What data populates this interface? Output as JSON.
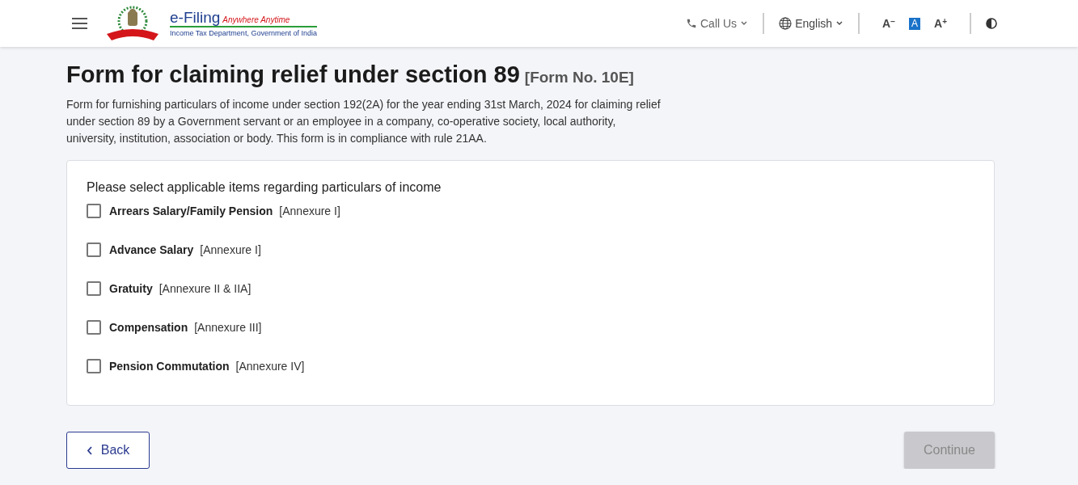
{
  "header": {
    "brand": {
      "name": "e-Filing",
      "tagline": "Anywhere Anytime",
      "department": "Income Tax Department, Government of India"
    },
    "call_us": {
      "label": "Call Us"
    },
    "language": {
      "label": "English"
    },
    "font_size_buttons": [
      {
        "label": "A",
        "sign": "−",
        "selected": false
      },
      {
        "label": "A",
        "selected": true
      },
      {
        "label": "A",
        "sign": "+",
        "selected": false
      }
    ]
  },
  "page": {
    "title": "Form for claiming relief under section 89",
    "form_number": "[Form No. 10E]",
    "description": "Form for furnishing particulars of income under section 192(2A) for the year ending 31st March, 2024 for claiming relief under section 89 by a Government servant or an employee in a company, co-operative society, local authority, university, institution, association or body. This form is in compliance with rule 21AA."
  },
  "selection": {
    "prompt": "Please select applicable items regarding particulars of income",
    "items": [
      {
        "label": "Arrears Salary/Family Pension",
        "annexure": "[Annexure I]",
        "checked": false
      },
      {
        "label": "Advance Salary",
        "annexure": "[Annexure I]",
        "checked": false
      },
      {
        "label": "Gratuity",
        "annexure": "[Annexure II & IIA]",
        "checked": false
      },
      {
        "label": "Compensation",
        "annexure": "[Annexure III]",
        "checked": false
      },
      {
        "label": "Pension Commutation",
        "annexure": "[Annexure IV]",
        "checked": false
      }
    ]
  },
  "buttons": {
    "back": {
      "label": "Back"
    },
    "continue": {
      "label": "Continue",
      "disabled": true
    }
  }
}
